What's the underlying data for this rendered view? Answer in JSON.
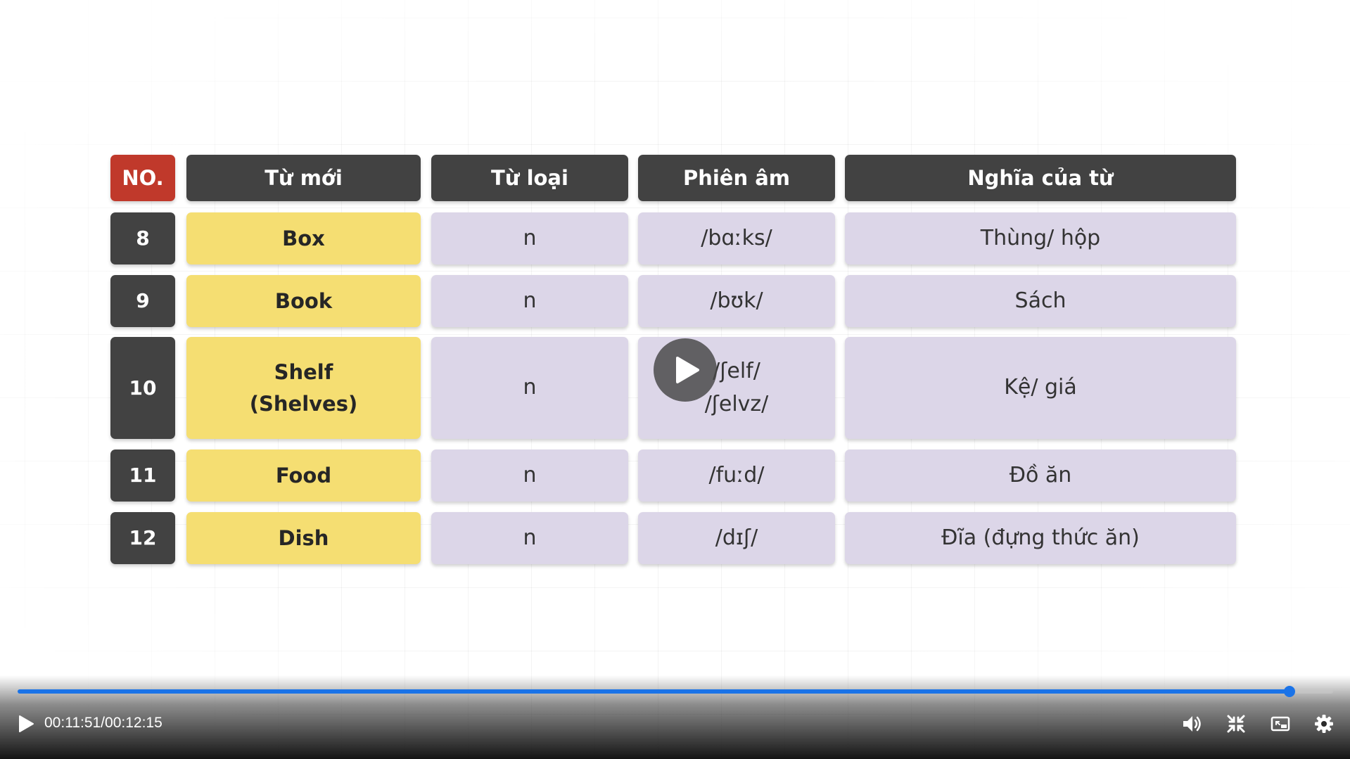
{
  "table": {
    "headers": [
      "NO.",
      "Từ mới",
      "Từ loại",
      "Phiên âm",
      "Nghĩa của từ"
    ],
    "rows": [
      {
        "no": "8",
        "word": "Box",
        "type": "n",
        "phonetic": "/bɑːks/",
        "meaning": "Thùng/ hộp"
      },
      {
        "no": "9",
        "word": "Book",
        "type": "n",
        "phonetic": "/bʊk/",
        "meaning": "Sách"
      },
      {
        "no": "10",
        "word": "Shelf\n(Shelves)",
        "type": "n",
        "phonetic": "/ʃelf/\n/ʃelvz/",
        "meaning": "Kệ/ giá"
      },
      {
        "no": "11",
        "word": "Food",
        "type": "n",
        "phonetic": "/fuːd/",
        "meaning": "Đồ ăn"
      },
      {
        "no": "12",
        "word": "Dish",
        "type": "n",
        "phonetic": "/dɪʃ/",
        "meaning": "Đĩa (đựng thức ăn)"
      }
    ]
  },
  "player": {
    "time_display": "00:11:51/00:12:15",
    "progress": 0.967,
    "accent_color": "#1a73e8",
    "icons": [
      "play-icon",
      "volume-icon",
      "exit-fullscreen-icon",
      "picture-in-picture-icon",
      "settings-gear-icon"
    ]
  }
}
